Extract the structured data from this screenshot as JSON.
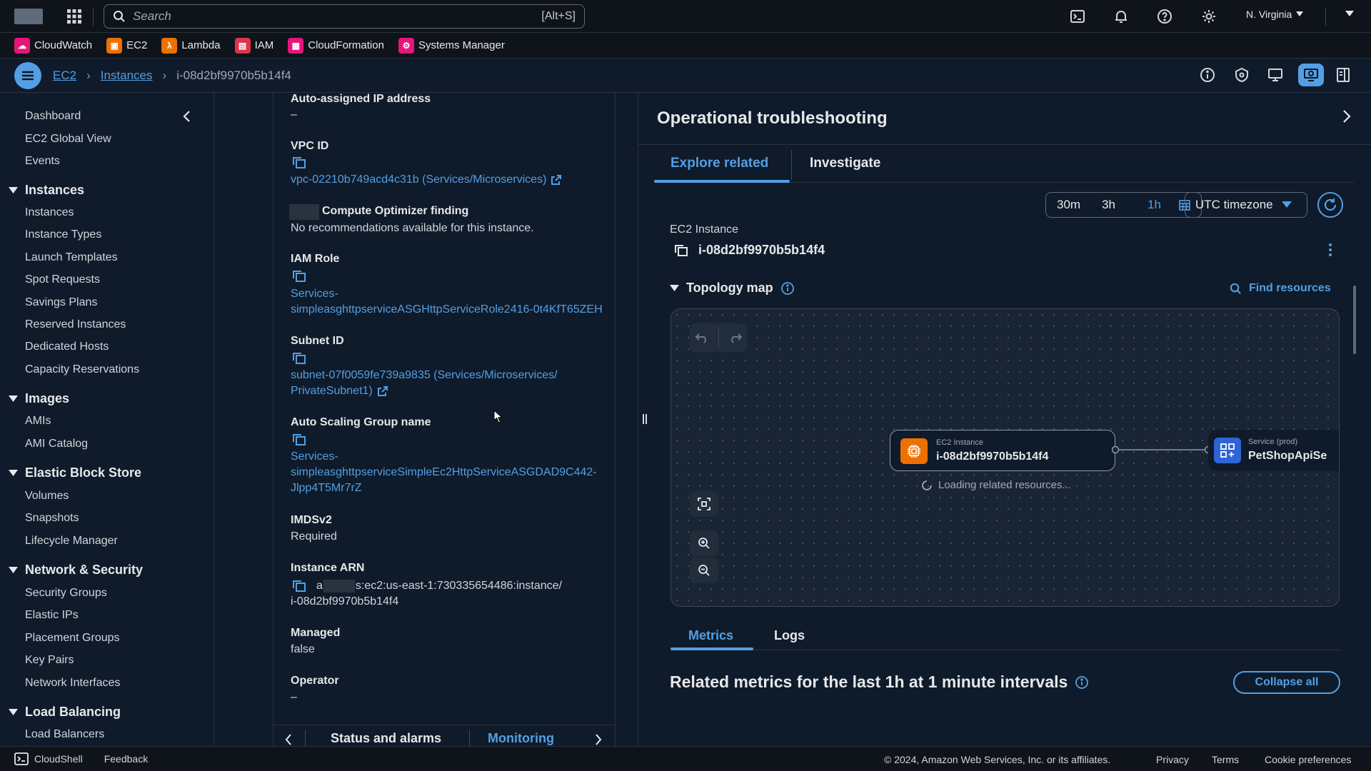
{
  "search": {
    "placeholder": "Search",
    "shortcut": "[Alt+S]"
  },
  "header": {
    "region": "N. Virginia"
  },
  "favorites": [
    {
      "label": "CloudWatch",
      "icon": "cloudwatch-icon",
      "color": "#e7157b"
    },
    {
      "label": "EC2",
      "icon": "ec2-icon",
      "color": "#ed7100"
    },
    {
      "label": "Lambda",
      "icon": "lambda-icon",
      "color": "#ed7100"
    },
    {
      "label": "IAM",
      "icon": "iam-icon",
      "color": "#dd344c"
    },
    {
      "label": "CloudFormation",
      "icon": "cloudformation-icon",
      "color": "#e7157b"
    },
    {
      "label": "Systems Manager",
      "icon": "systems-manager-icon",
      "color": "#e7157b"
    }
  ],
  "breadcrumb": {
    "service": "EC2",
    "section": "Instances",
    "current": "i-08d2bf9970b5b14f4"
  },
  "sidebar": {
    "top_links": [
      "Dashboard",
      "EC2 Global View",
      "Events"
    ],
    "sections": [
      {
        "title": "Instances",
        "items": [
          "Instances",
          "Instance Types",
          "Launch Templates",
          "Spot Requests",
          "Savings Plans",
          "Reserved Instances",
          "Dedicated Hosts",
          "Capacity Reservations"
        ]
      },
      {
        "title": "Images",
        "items": [
          "AMIs",
          "AMI Catalog"
        ]
      },
      {
        "title": "Elastic Block Store",
        "items": [
          "Volumes",
          "Snapshots",
          "Lifecycle Manager"
        ]
      },
      {
        "title": "Network & Security",
        "items": [
          "Security Groups",
          "Elastic IPs",
          "Placement Groups",
          "Key Pairs",
          "Network Interfaces"
        ]
      },
      {
        "title": "Load Balancing",
        "items": [
          "Load Balancers"
        ]
      }
    ]
  },
  "details": {
    "auto_ip": {
      "label": "Auto-assigned IP address",
      "value": "–"
    },
    "vpc": {
      "label": "VPC ID",
      "value": "vpc-02210b749acd4c31b (Services/Microservices)"
    },
    "optimizer": {
      "label": "Compute Optimizer finding",
      "value": "No recommendations available for this instance."
    },
    "iam_role": {
      "label": "IAM Role",
      "line1": "Services-",
      "line2": "simpleasghttpserviceASGHttpServiceRole2416-0t4KfT65ZEH"
    },
    "subnet": {
      "label": "Subnet ID",
      "line1": "subnet-07f0059fe739a9835 (Services/Microservices/",
      "line2": "PrivateSubnet1)"
    },
    "asg": {
      "label": "Auto Scaling Group name",
      "line1": "Services-",
      "line2": "simpleasghttpserviceSimpleEc2HttpServiceASGDAD9C442-",
      "line3": "Jlpp4T5Mr7rZ"
    },
    "imds": {
      "label": "IMDSv2",
      "value": "Required"
    },
    "arn": {
      "label": "Instance ARN",
      "line1_prefix": "a",
      "line1_suffix": "s:ec2:us-east-1:730335654486:instance/",
      "line2": "i-08d2bf9970b5b14f4"
    },
    "managed": {
      "label": "Managed",
      "value": "false"
    },
    "operator": {
      "label": "Operator",
      "value": "–"
    },
    "tabs": [
      "Status and alarms",
      "Monitoring"
    ]
  },
  "panel": {
    "title": "Operational troubleshooting",
    "tabs": [
      "Explore related",
      "Investigate"
    ],
    "time_ranges": [
      "30m",
      "3h",
      "1h"
    ],
    "active_range": "1h",
    "timezone": "UTC timezone",
    "resource_type": "EC2 Instance",
    "resource_id": "i-08d2bf9970b5b14f4",
    "topology_title": "Topology map",
    "find_resources": "Find resources",
    "nodes": [
      {
        "type": "EC2 Instance",
        "name": "i-08d2bf9970b5b14f4",
        "color": "#ed7100"
      },
      {
        "type": "Service (prod)",
        "name": "PetShopApiSe",
        "color": "#2f64d6"
      }
    ],
    "loading_text": "Loading related resources...",
    "metric_tabs": [
      "Metrics",
      "Logs"
    ],
    "metrics_heading": "Related metrics for the last 1h at 1 minute intervals",
    "collapse_all": "Collapse all"
  },
  "footer": {
    "cloudshell": "CloudShell",
    "feedback": "Feedback",
    "copyright": "© 2024, Amazon Web Services, Inc. or its affiliates.",
    "privacy": "Privacy",
    "terms": "Terms",
    "cookie": "Cookie preferences"
  },
  "colors": {
    "accent": "#539fe5",
    "background": "#0f1b2a",
    "topbar": "#0f141a"
  }
}
